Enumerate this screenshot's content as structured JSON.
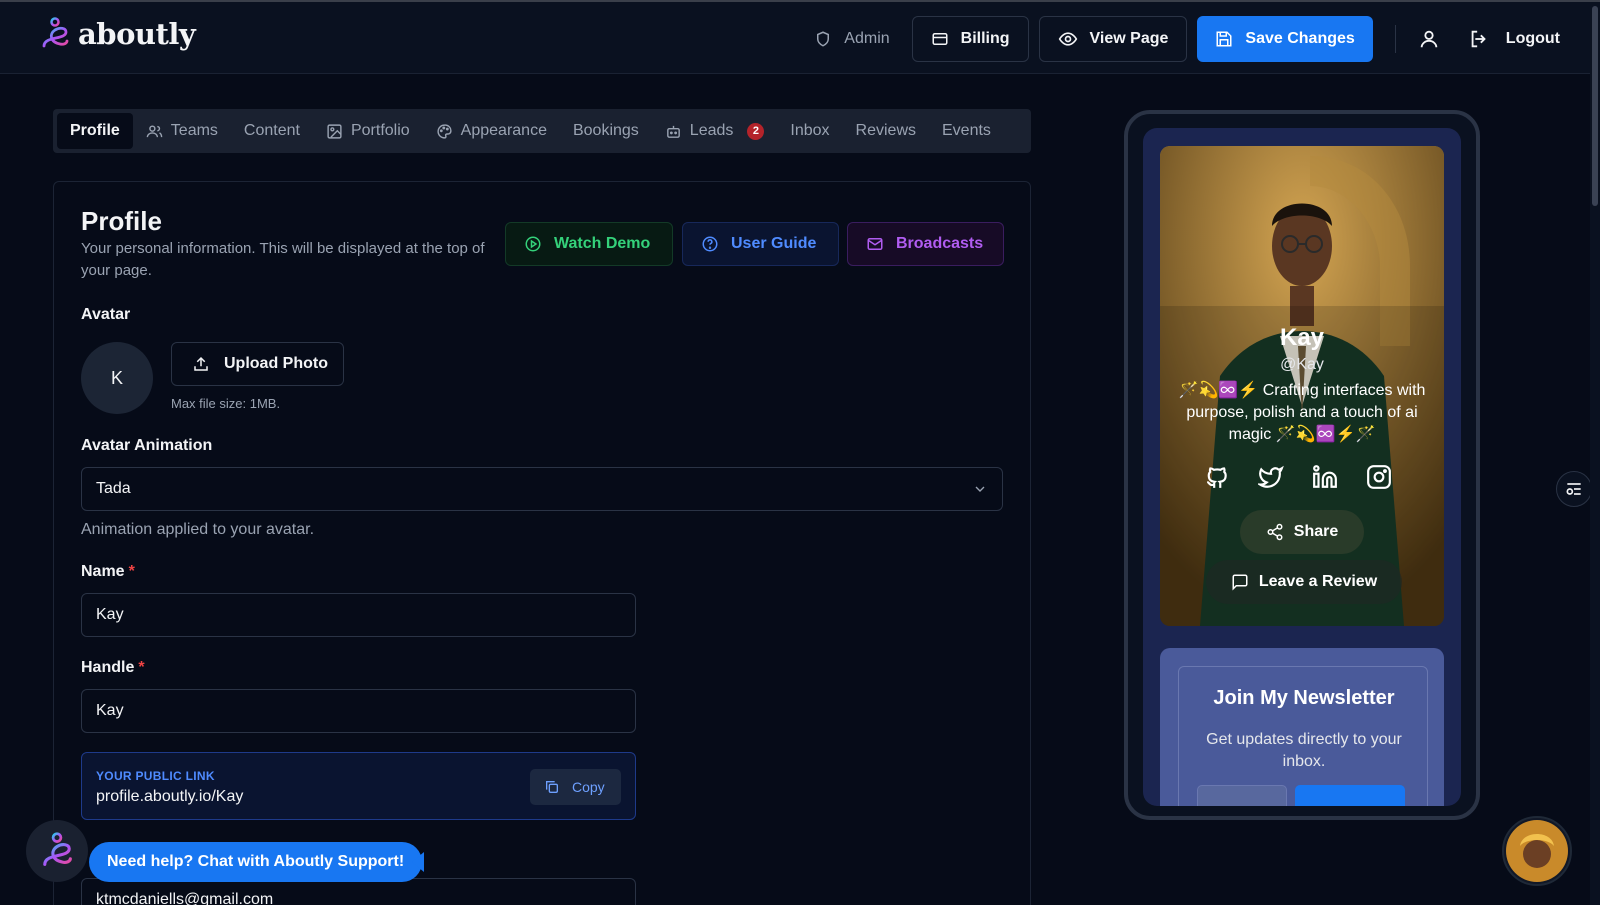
{
  "brand": {
    "name": "aboutly"
  },
  "nav": {
    "admin": "Admin",
    "billing": "Billing",
    "view_page": "View Page",
    "save": "Save Changes",
    "logout": "Logout"
  },
  "tabs": [
    {
      "label": "Profile",
      "icon": "",
      "active": true
    },
    {
      "label": "Teams",
      "icon": "users-icon"
    },
    {
      "label": "Content",
      "icon": ""
    },
    {
      "label": "Portfolio",
      "icon": "image-icon"
    },
    {
      "label": "Appearance",
      "icon": "palette-icon"
    },
    {
      "label": "Bookings",
      "icon": ""
    },
    {
      "label": "Leads",
      "icon": "bot-icon",
      "badge": "2"
    },
    {
      "label": "Inbox",
      "icon": ""
    },
    {
      "label": "Reviews",
      "icon": ""
    },
    {
      "label": "Events",
      "icon": ""
    }
  ],
  "profile": {
    "title": "Profile",
    "description": "Your personal information. This will be displayed at the top of your page.",
    "buttons": {
      "demo": "Watch Demo",
      "guide": "User Guide",
      "broadcasts": "Broadcasts"
    },
    "avatar_label": "Avatar",
    "avatar_initial": "K",
    "upload": "Upload Photo",
    "max_size": "Max file size: 1MB.",
    "animation_label": "Avatar Animation",
    "animation_value": "Tada",
    "animation_help": "Animation applied to your avatar.",
    "name_label": "Name",
    "name_value": "Kay",
    "handle_label": "Handle",
    "handle_value": "Kay",
    "required_mark": "*",
    "public_link_caption": "YOUR PUBLIC LINK",
    "public_link": "profile.aboutly.io/Kay",
    "copy": "Copy",
    "email_value": "ktmcdaniells@gmail.com"
  },
  "help": {
    "chat": "Need help? Chat with Aboutly Support!"
  },
  "preview": {
    "name": "Kay",
    "handle": "@Kay",
    "bio": "🪄💫♾️⚡ Crafting interfaces with purpose, polish and a touch of ai magic 🪄💫♾️⚡🪄",
    "share": "Share",
    "review": "Leave a Review",
    "newsletter_title": "Join My Newsletter",
    "newsletter_desc": "Get updates directly to your inbox."
  },
  "colors": {
    "accent": "#1877f2",
    "background": "#060b18",
    "success": "#34d17a",
    "purple": "#b05cf0",
    "danger": "#ef4444"
  }
}
